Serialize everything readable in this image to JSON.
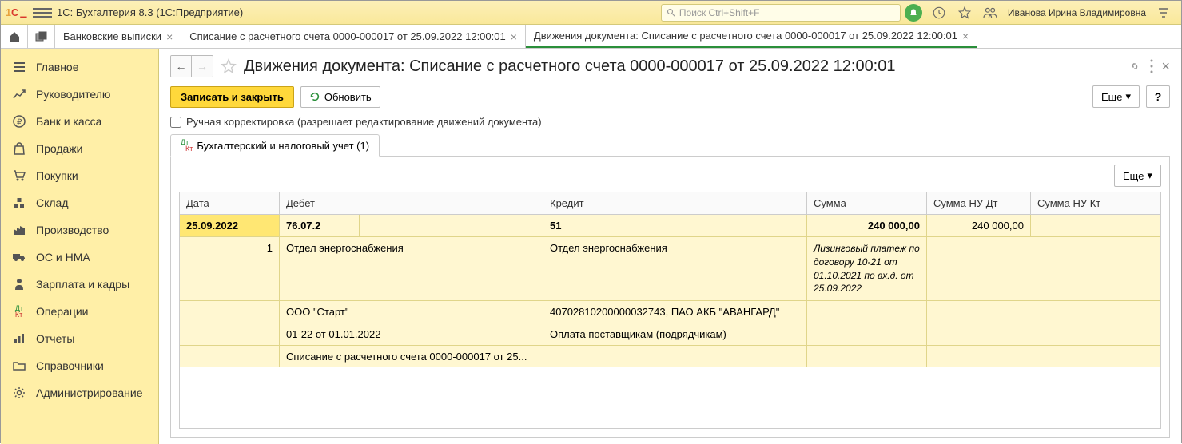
{
  "app": {
    "title": "1С: Бухгалтерия 8.3  (1С:Предприятие)"
  },
  "search": {
    "placeholder": "Поиск Ctrl+Shift+F"
  },
  "user": {
    "name": "Иванова Ирина Владимировна"
  },
  "tabs": [
    {
      "label": "Банковские выписки"
    },
    {
      "label": "Списание с расчетного счета 0000-000017 от 25.09.2022 12:00:01"
    },
    {
      "label": "Движения документа: Списание с расчетного счета 0000-000017 от 25.09.2022 12:00:01"
    }
  ],
  "sidebar": {
    "items": [
      {
        "label": "Главное"
      },
      {
        "label": "Руководителю"
      },
      {
        "label": "Банк и касса"
      },
      {
        "label": "Продажи"
      },
      {
        "label": "Покупки"
      },
      {
        "label": "Склад"
      },
      {
        "label": "Производство"
      },
      {
        "label": "ОС и НМА"
      },
      {
        "label": "Зарплата и кадры"
      },
      {
        "label": "Операции"
      },
      {
        "label": "Отчеты"
      },
      {
        "label": "Справочники"
      },
      {
        "label": "Администрирование"
      }
    ]
  },
  "page": {
    "title": "Движения документа: Списание с расчетного счета 0000-000017 от 25.09.2022 12:00:01",
    "write_close": "Записать и закрыть",
    "refresh": "Обновить",
    "manual_edit": "Ручная корректировка (разрешает редактирование движений документа)",
    "more": "Еще",
    "inner_tab": "Бухгалтерский и налоговый учет (1)"
  },
  "grid": {
    "headers": {
      "date": "Дата",
      "debet": "Дебет",
      "kredit": "Кредит",
      "summa": "Сумма",
      "summadt": "Сумма НУ Дт",
      "summakt": "Сумма НУ Кт"
    },
    "row": {
      "date": "25.09.2022",
      "debet_acc": "76.07.2",
      "kredit_acc": "51",
      "summa": "240 000,00",
      "summadt": "240 000,00",
      "seq": "1",
      "d1": "Отдел энергоснабжения",
      "k1": "Отдел энергоснабжения",
      "d2": "ООО \"Старт\"",
      "k2": "40702810200000032743, ПАО АКБ \"АВАНГАРД\"",
      "d3": "01-22 от 01.01.2022",
      "k3": "Оплата поставщикам (подрядчикам)",
      "d4": "Списание с расчетного счета 0000-000017 от 25...",
      "desc": "Лизинговый платеж по договору 10-21 от 01.10.2021 по вх.д. от 25.09.2022"
    }
  }
}
